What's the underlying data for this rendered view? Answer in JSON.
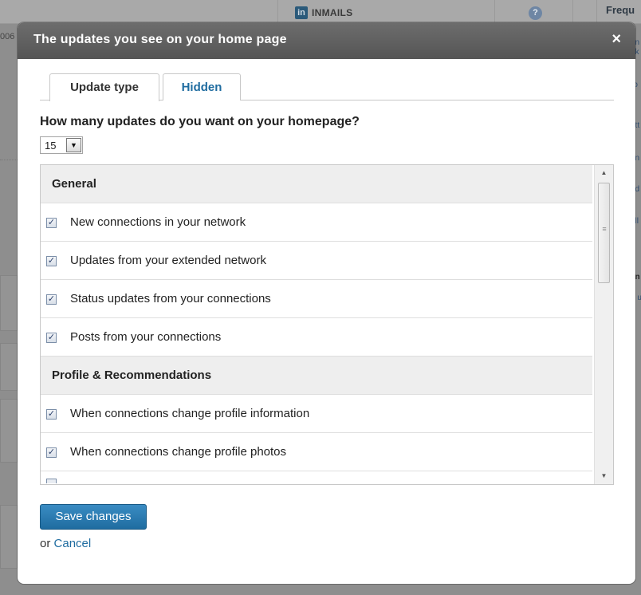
{
  "background": {
    "inmails_label": "INMAILS",
    "help_glyph": "?",
    "frequency_label": "Frequ",
    "linkedin_icon_text": "in",
    "left_snippet": "006",
    "right_snippets": [
      "an",
      "nk",
      "ro",
      "e",
      "ett",
      "an",
      "od",
      "all",
      "an",
      ".",
      "d u"
    ]
  },
  "modal": {
    "title": "The updates you see on your home page",
    "close_glyph": "×",
    "tabs": [
      {
        "label": "Update type",
        "active": true
      },
      {
        "label": "Hidden",
        "active": false
      }
    ],
    "question": "How many updates do you want on your homepage?",
    "count_selected": "15",
    "count_arrow_glyph": "▼",
    "groups": [
      {
        "title": "General",
        "items": [
          {
            "label": "New connections in your network",
            "checked": true
          },
          {
            "label": "Updates from your extended network",
            "checked": true
          },
          {
            "label": "Status updates from your connections",
            "checked": true
          },
          {
            "label": "Posts from your connections",
            "checked": true
          }
        ]
      },
      {
        "title": "Profile & Recommendations",
        "items": [
          {
            "label": "When connections change profile information",
            "checked": true
          },
          {
            "label": "When connections change profile photos",
            "checked": true
          }
        ]
      }
    ],
    "checkmark_glyph": "✓",
    "scroll_up_glyph": "▲",
    "scroll_down_glyph": "▼",
    "save_label": "Save changes",
    "cancel_prefix": "or",
    "cancel_label": "Cancel"
  },
  "colors": {
    "accent": "#1f6ca0",
    "header_bg": "#5e5e5e",
    "overlay": "#8e8e8e"
  }
}
